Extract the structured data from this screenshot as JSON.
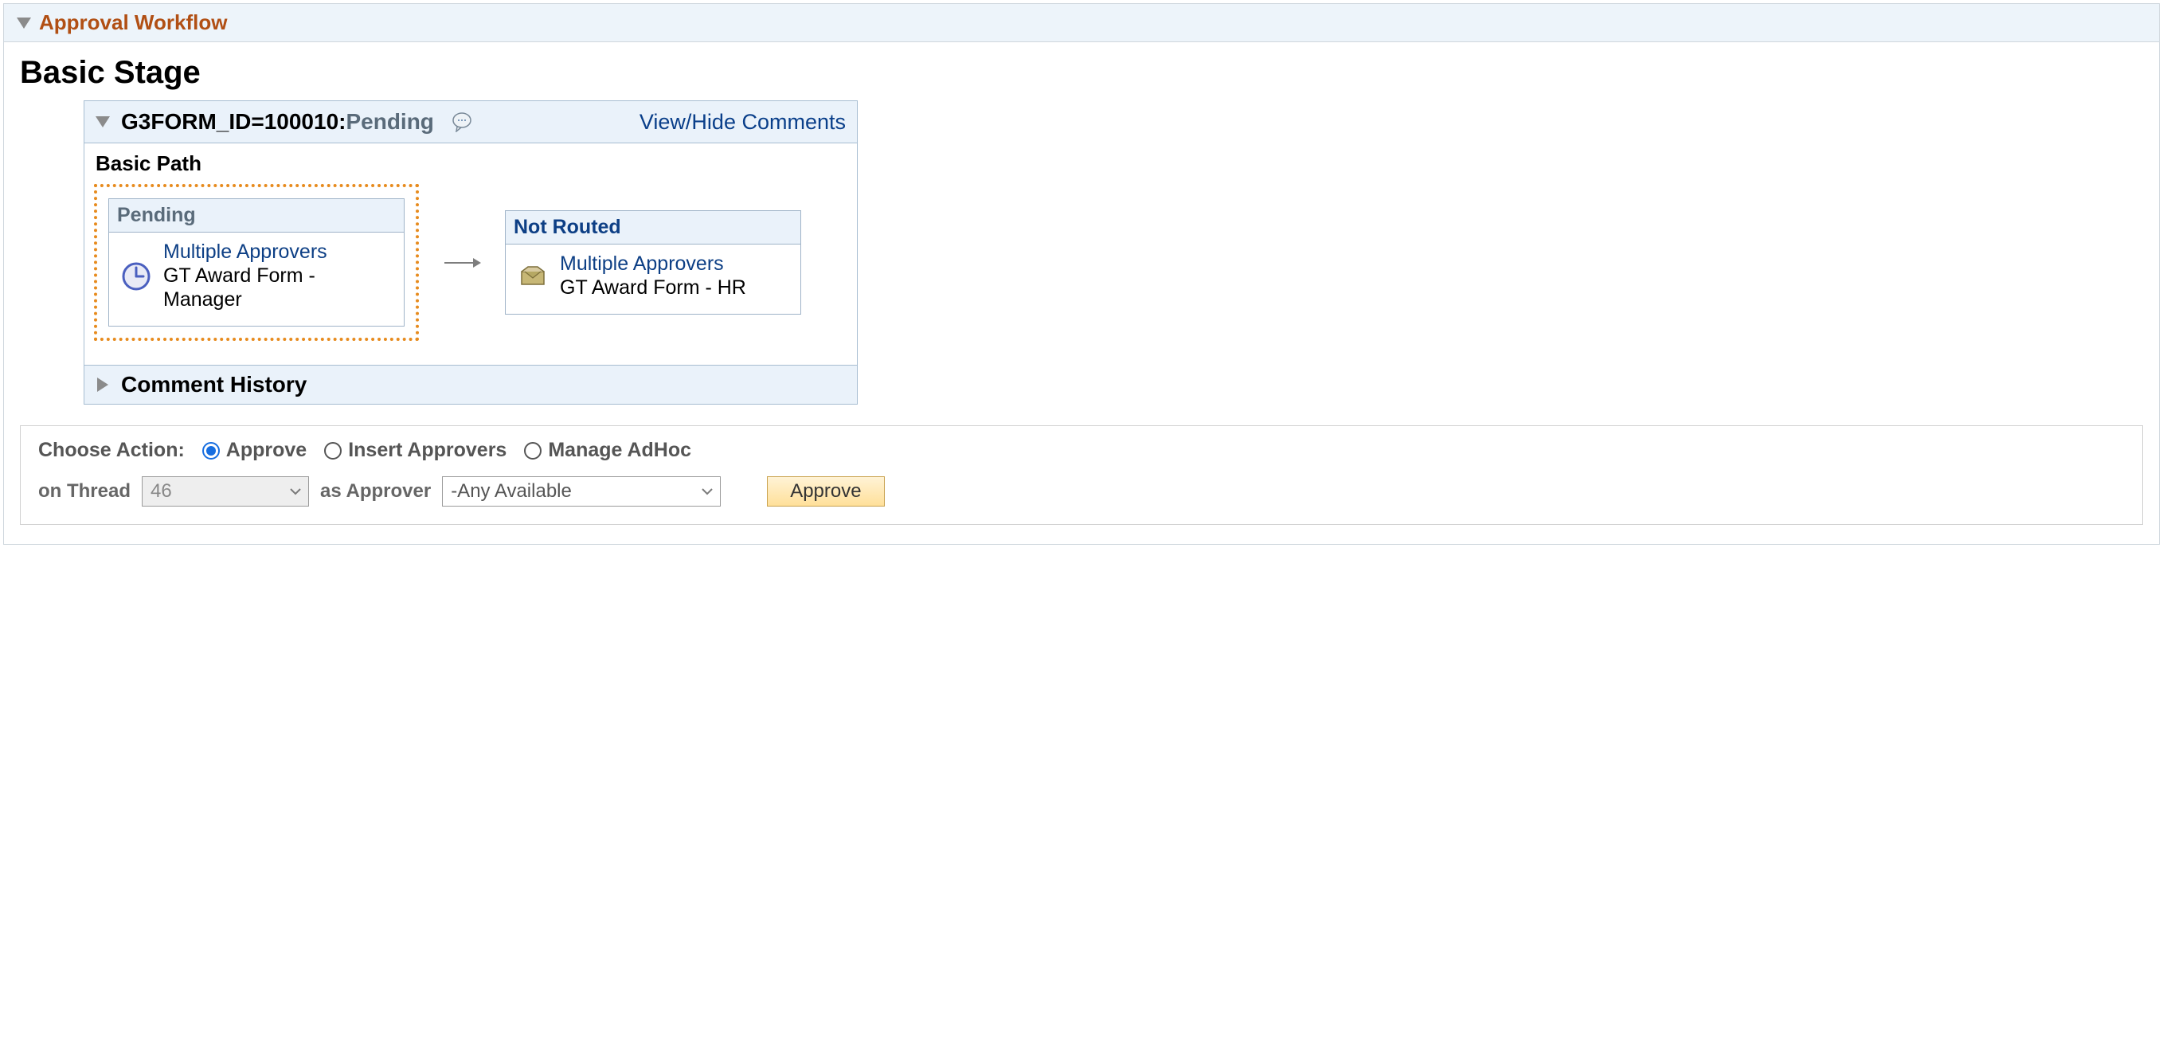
{
  "panel": {
    "title": "Approval Workflow"
  },
  "stage_title": "Basic Stage",
  "workflow": {
    "form_label": "G3FORM_ID=100010:",
    "status": "Pending",
    "comments_link": "View/Hide Comments",
    "path_title": "Basic Path",
    "steps": [
      {
        "status": "Pending",
        "approvers_link": "Multiple Approvers",
        "role": "GT Award Form - Manager",
        "active": true
      },
      {
        "status": "Not Routed",
        "approvers_link": "Multiple Approvers",
        "role": "GT Award Form - HR",
        "active": false
      }
    ],
    "history_title": "Comment History"
  },
  "action": {
    "choose_label": "Choose Action:",
    "options": {
      "approve": "Approve",
      "insert": "Insert Approvers",
      "adhoc": "Manage AdHoc"
    },
    "selected": "approve",
    "on_thread_label": "on Thread",
    "thread_value": "46",
    "as_approver_label": "as Approver",
    "approver_value": "-Any Available",
    "button_label": "Approve"
  }
}
